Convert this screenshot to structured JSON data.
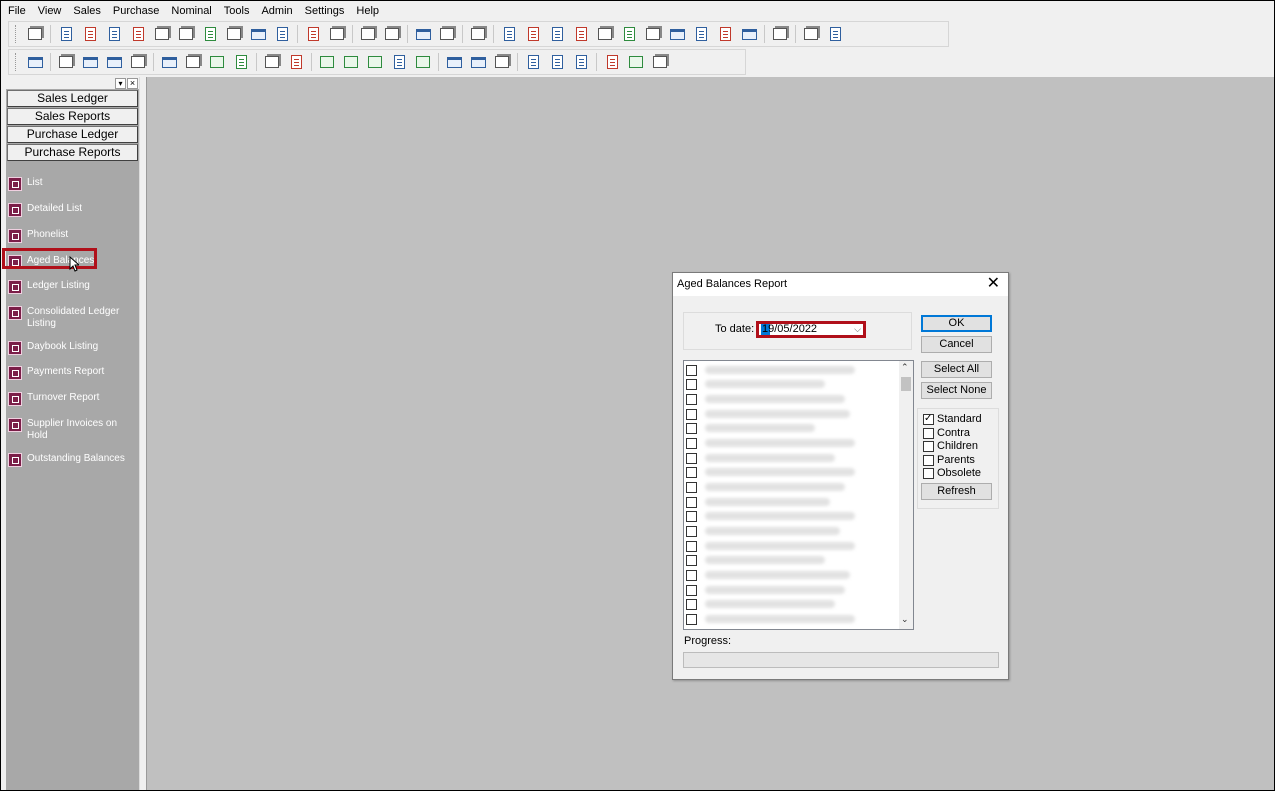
{
  "menu": [
    "File",
    "View",
    "Sales",
    "Purchase",
    "Nominal",
    "Tools",
    "Admin",
    "Settings",
    "Help"
  ],
  "left_panel": {
    "nav_buttons": [
      "Sales Ledger",
      "Sales Reports",
      "Purchase Ledger",
      "Purchase Reports"
    ],
    "items": [
      "List",
      "Detailed List",
      "Phonelist",
      "Aged Balances",
      "Ledger Listing",
      "Consolidated Ledger Listing",
      "Daybook Listing",
      "Payments Report",
      "Turnover Report",
      "Supplier Invoices on Hold",
      "Outstanding Balances"
    ],
    "highlighted_item": "Aged Balances"
  },
  "dialog": {
    "title": "Aged Balances Report",
    "close_glyph": "✕",
    "to_date_label": "To date:",
    "to_date_value": "19/05/2022",
    "buttons": {
      "ok": "OK",
      "cancel": "Cancel",
      "select_all": "Select All",
      "select_none": "Select None",
      "refresh": "Refresh"
    },
    "filters": [
      {
        "label": "Standard",
        "checked": true
      },
      {
        "label": "Contra",
        "checked": false
      },
      {
        "label": "Children",
        "checked": false
      },
      {
        "label": "Parents",
        "checked": false
      },
      {
        "label": "Obsolete",
        "checked": false
      }
    ],
    "progress_label": "Progress:",
    "progress_value": 0
  },
  "colors": {
    "highlight_border": "#b0101a",
    "mdi_background": "#c0c0c0",
    "left_panel_background": "#a8a8a8",
    "selection_blue": "#0078d7"
  }
}
